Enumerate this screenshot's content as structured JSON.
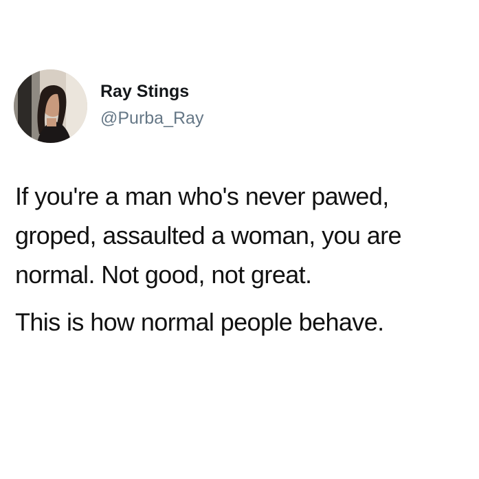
{
  "tweet": {
    "author": {
      "display_name": "Ray Stings",
      "handle": "@Purba_Ray",
      "avatar_icon": "profile-photo"
    },
    "text": {
      "paragraph_1": "If you're a man who's never pawed, groped, assaulted a woman, you are normal. Not good, not great.",
      "paragraph_2": "This is how normal people behave."
    }
  },
  "colors": {
    "background": "#ffffff",
    "name_text": "#14171a",
    "handle_text": "#657786",
    "body_text": "#111111"
  }
}
